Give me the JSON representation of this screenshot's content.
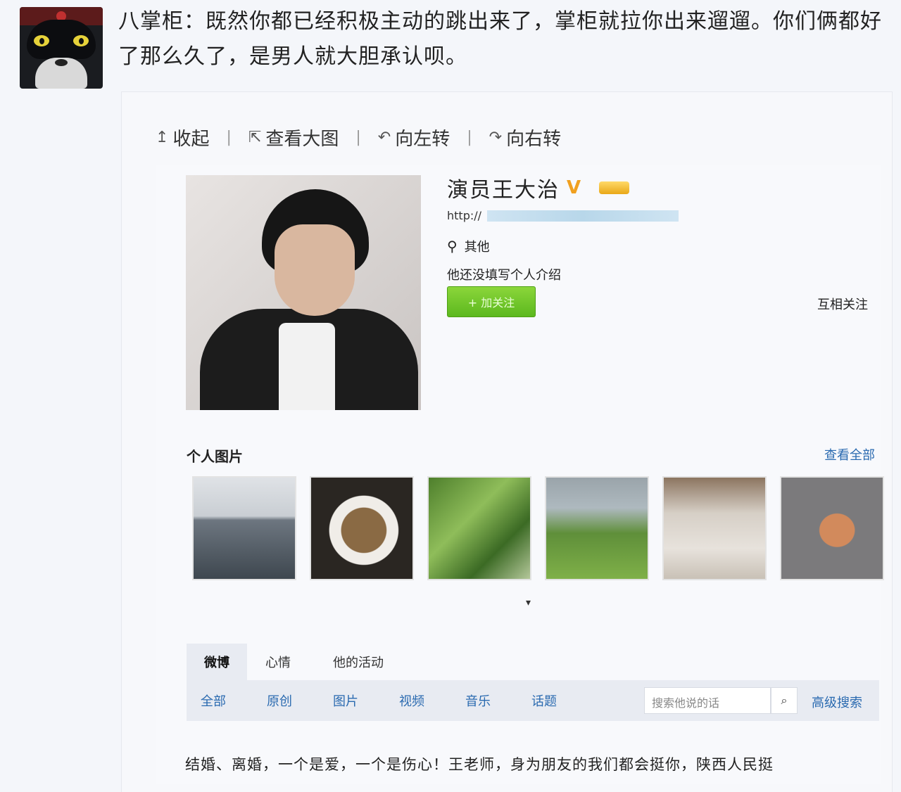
{
  "post": {
    "text": "八掌柜：既然你都已经积极主动的跳出来了，掌柜就拉你出来遛遛。你们俩都好了那么久了，是男人就大胆承认呗。"
  },
  "toolbar": {
    "collapse": "收起",
    "collapse_icon": "↥",
    "view_large": "查看大图",
    "view_large_icon": "⇱",
    "rotate_left": "向左转",
    "rotate_left_icon": "↶",
    "rotate_right": "向右转",
    "rotate_right_icon": "↷",
    "separator": "|"
  },
  "profile": {
    "name": "演员王大治",
    "verified_mark": "V",
    "url_prefix": "http://",
    "location_icon": "pin-icon",
    "location": "其他",
    "intro": "他还没填写个人介绍",
    "follow_button": "+ 加关注",
    "mutual": "互相关注"
  },
  "photos": {
    "title": "个人图片",
    "view_all": "查看全部"
  },
  "tabs": [
    "微博",
    "心情",
    "他的活动"
  ],
  "filters": [
    "全部",
    "原创",
    "图片",
    "视频",
    "音乐",
    "话题"
  ],
  "search": {
    "placeholder": "搜索他说的话",
    "advanced": "高级搜索"
  },
  "weibo": {
    "text": "结婚、离婚，一个是爱，一个是伤心！王老师，身为朋友的我们都会挺你，陕西人民挺"
  },
  "colors": {
    "link": "#2a6ab0",
    "follow_green": "#5cb81e",
    "verified_orange": "#f0a020"
  }
}
